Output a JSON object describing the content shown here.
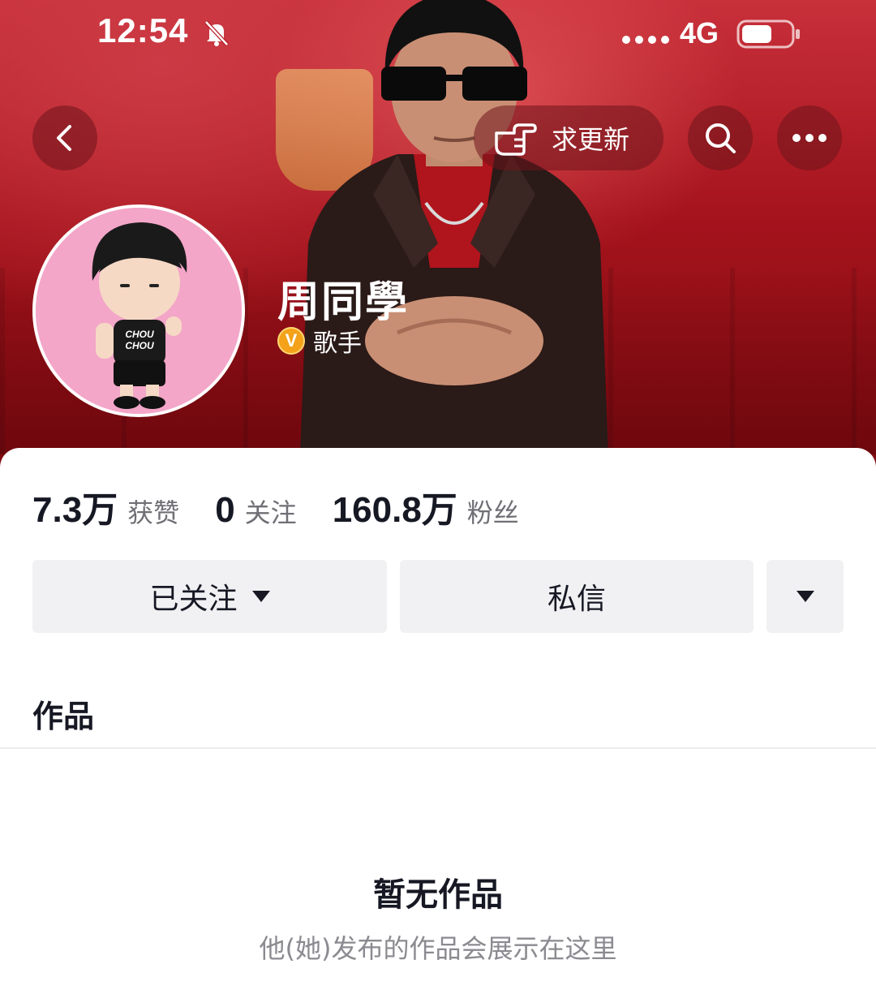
{
  "status_bar": {
    "time": "12:54",
    "network": "4G",
    "icons": [
      "bell-muted-icon",
      "signal-dots-icon",
      "battery-icon"
    ]
  },
  "nav": {
    "back_icon": "chevron-left-icon",
    "update_label": "求更新",
    "update_icon": "pointing-hand-icon",
    "search_icon": "search-icon",
    "more_icon": "more-dots-icon"
  },
  "profile": {
    "name": "周同學",
    "verify_badge": "V",
    "verify_label": "歌手",
    "avatar_text": [
      "CHOU",
      "CHOU"
    ]
  },
  "stats": [
    {
      "value": "7.3万",
      "label": "获赞"
    },
    {
      "value": "0",
      "label": "关注"
    },
    {
      "value": "160.8万",
      "label": "粉丝"
    }
  ],
  "actions": {
    "follow_label": "已关注",
    "message_label": "私信"
  },
  "tabs": {
    "works_label": "作品"
  },
  "empty_state": {
    "title": "暂无作品",
    "subtitle": "他(她)发布的作品会展示在这里"
  },
  "colors": {
    "banner_red": "#a5131c",
    "verify_gold": "#f4a21a",
    "button_gray": "#f1f1f3",
    "text_primary": "#161823",
    "text_secondary": "#6f6f75"
  }
}
